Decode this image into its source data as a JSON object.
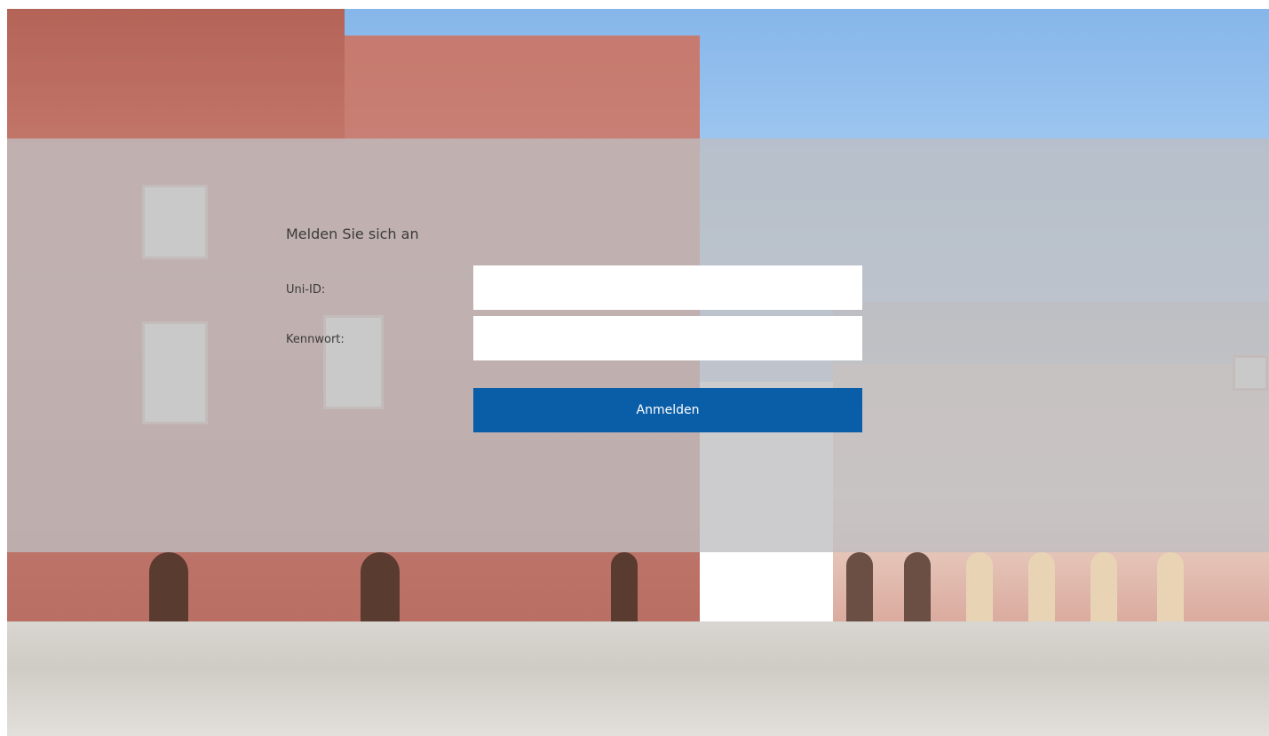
{
  "login": {
    "heading": "Melden Sie sich an",
    "uid_label": "Uni-ID:",
    "uid_value": "",
    "password_label": "Kennwort:",
    "password_value": "",
    "submit_label": "Anmelden"
  },
  "colors": {
    "button_bg": "#0a5ea8",
    "overlay": "#bebec0"
  }
}
